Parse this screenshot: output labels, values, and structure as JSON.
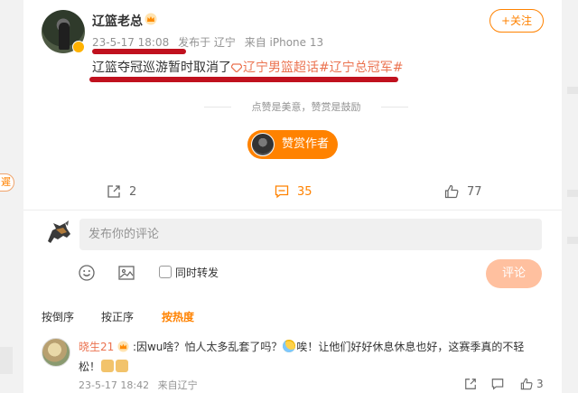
{
  "left_edge": {
    "pill_text": "遲"
  },
  "post": {
    "username": "辽篮老总",
    "date": "23-5-17 18:08",
    "location": "发布于 辽宁",
    "device": "来自 iPhone 13",
    "follow_label": "+关注",
    "text": "辽篮夺冠巡游暂时取消了",
    "topics": "辽宁男篮超话#辽宁总冠军#",
    "reward_note": "点赞是美意，赞赏是鼓励",
    "reward_button": "赞赏作者"
  },
  "actions": {
    "repost_count": "2",
    "comment_count": "35",
    "like_count": "77"
  },
  "composer": {
    "placeholder": "发布你的评论",
    "repost_label": "同时转发",
    "submit_label": "评论"
  },
  "sort_tabs": [
    "按倒序",
    "按正序",
    "按热度"
  ],
  "comment": {
    "author": "晓生21",
    "text_a": ":因wu啥？怕人太多乱套了吗？",
    "text_b": "唉！让他们好好休息休息也好，这赛季真的不轻",
    "text_c": "松！",
    "date": "23-5-17 18:42",
    "location": "来自辽宁",
    "like_count": "3"
  },
  "colors": {
    "accent": "#ff8200",
    "topic": "#eb7350",
    "annotation_red": "#c0111e"
  },
  "icons": [
    "crown-icon",
    "diamond-icon",
    "repost-icon",
    "comment-icon",
    "like-icon",
    "emoji-icon",
    "image-icon",
    "share-icon",
    "reply-icon"
  ]
}
